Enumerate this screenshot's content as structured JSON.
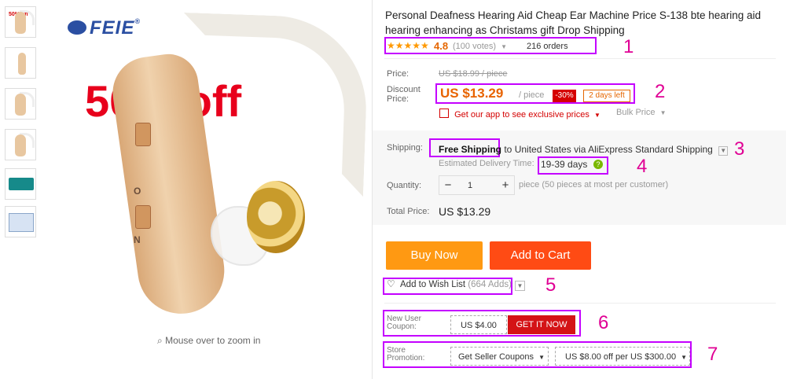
{
  "product": {
    "title": "Personal Deafness Hearing Aid Cheap Ear Machine Price S-138 bte hearing aid hearing enhancing as Christams gift Drop Shipping",
    "stars_icon": "★★★★★",
    "rating": "4.8",
    "votes": "(100 votes)",
    "orders": "216 orders"
  },
  "image": {
    "brand_logo_text": "FEIE",
    "promo_text": "50% off",
    "zoom_hint": "Mouse over to zoom in",
    "thumb_promo": "50% off"
  },
  "pricing": {
    "price_label": "Price:",
    "old_price": "US $18.99 / piece",
    "discount_label_1": "Discount",
    "discount_label_2": "Price:",
    "discount_price": "US $13.29",
    "unit": "/ piece",
    "discount_badge": "-30%",
    "days_left": "2 days left",
    "app_promo": "Get our app to see exclusive prices",
    "bulk_price": "Bulk Price"
  },
  "shipping": {
    "label": "Shipping:",
    "free_text": "Free Shipping",
    "destination_text": " to United States via AliExpress Standard Shipping",
    "eta_label": "Estimated Delivery Time:",
    "eta_days": "19-39 days"
  },
  "quantity": {
    "label": "Quantity:",
    "minus": "−",
    "value": "1",
    "plus": "+",
    "note": "piece (50 pieces at most per customer)"
  },
  "total": {
    "label": "Total Price:",
    "value": "US $13.29"
  },
  "actions": {
    "buy_now": "Buy Now",
    "add_to_cart": "Add to Cart"
  },
  "wishlist": {
    "text": "Add to Wish List",
    "count": "(664 Adds)"
  },
  "coupon": {
    "new_user_label": "New User Coupon:",
    "new_user_value": "US $4.00",
    "get_it_now": "GET IT NOW",
    "store_promo_label": "Store Promotion:",
    "seller_coupons": "Get Seller Coupons",
    "store_offer": "US $8.00 off per US $300.00"
  },
  "annotations": {
    "a1": "1",
    "a2": "2",
    "a3": "3",
    "a4": "4",
    "a5": "5",
    "a6": "6",
    "a7": "7"
  },
  "colors": {
    "accent_orange": "#ff9912",
    "accent_red": "#ff4b14",
    "annotation_magenta": "#c400ff",
    "price_orange": "#e86300"
  }
}
